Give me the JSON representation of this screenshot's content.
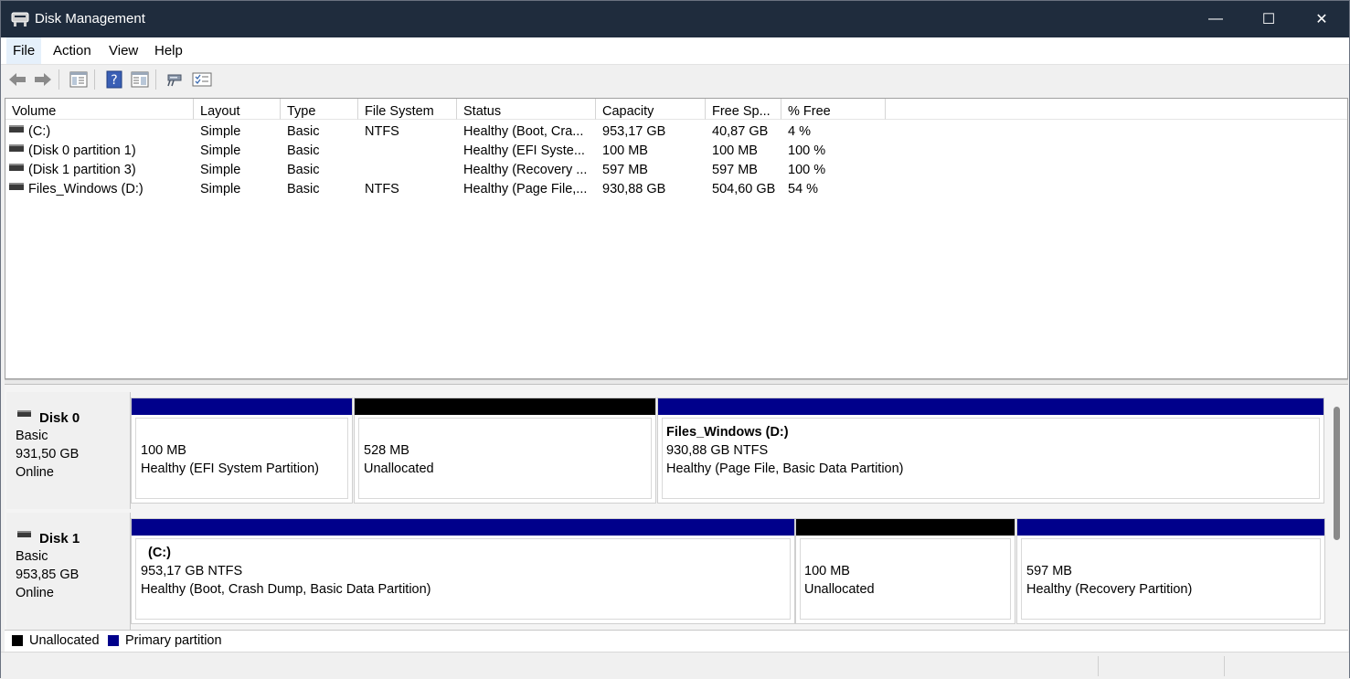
{
  "window": {
    "title": "Disk Management",
    "minimize": "—",
    "maximize": "☐",
    "close": "✕"
  },
  "menu": [
    "File",
    "Action",
    "View",
    "Help"
  ],
  "columns": [
    "Volume",
    "Layout",
    "Type",
    "File System",
    "Status",
    "Capacity",
    "Free Sp...",
    "% Free"
  ],
  "volumes": [
    {
      "volume": "(C:)",
      "layout": "Simple",
      "type": "Basic",
      "fs": "NTFS",
      "status": "Healthy (Boot, Cra...",
      "capacity": "953,17 GB",
      "free": "40,87 GB",
      "pct": "4 %"
    },
    {
      "volume": "(Disk 0 partition 1)",
      "layout": "Simple",
      "type": "Basic",
      "fs": "",
      "status": "Healthy (EFI Syste...",
      "capacity": "100 MB",
      "free": "100 MB",
      "pct": "100 %"
    },
    {
      "volume": "(Disk 1 partition 3)",
      "layout": "Simple",
      "type": "Basic",
      "fs": "",
      "status": "Healthy (Recovery ...",
      "capacity": "597 MB",
      "free": "597 MB",
      "pct": "100 %"
    },
    {
      "volume": "Files_Windows (D:)",
      "layout": "Simple",
      "type": "Basic",
      "fs": "NTFS",
      "status": "Healthy (Page File,...",
      "capacity": "930,88 GB",
      "free": "504,60 GB",
      "pct": "54 %"
    }
  ],
  "disks": [
    {
      "name": "Disk 0",
      "type": "Basic",
      "size": "931,50 GB",
      "state": "Online",
      "partitions": [
        {
          "title": "",
          "line1": "100 MB",
          "line2": "Healthy (EFI System Partition)",
          "kind": "primary"
        },
        {
          "title": "",
          "line1": "528 MB",
          "line2": "Unallocated",
          "kind": "unallocated"
        },
        {
          "title": "Files_Windows  (D:)",
          "line1": "930,88 GB NTFS",
          "line2": "Healthy (Page File, Basic Data Partition)",
          "kind": "primary"
        }
      ]
    },
    {
      "name": "Disk 1",
      "type": "Basic",
      "size": "953,85 GB",
      "state": "Online",
      "partitions": [
        {
          "title": "(C:)",
          "line1": "953,17 GB NTFS",
          "line2": "Healthy (Boot, Crash Dump, Basic Data Partition)",
          "kind": "primary"
        },
        {
          "title": "",
          "line1": "100 MB",
          "line2": "Unallocated",
          "kind": "unallocated"
        },
        {
          "title": "",
          "line1": "597 MB",
          "line2": "Healthy (Recovery Partition)",
          "kind": "primary"
        }
      ]
    }
  ],
  "legend": {
    "unallocated": "Unallocated",
    "primary": "Primary partition"
  },
  "colors": {
    "primary": "#00008b",
    "unallocated": "#000000",
    "titlebar": "#1f2c3d"
  }
}
